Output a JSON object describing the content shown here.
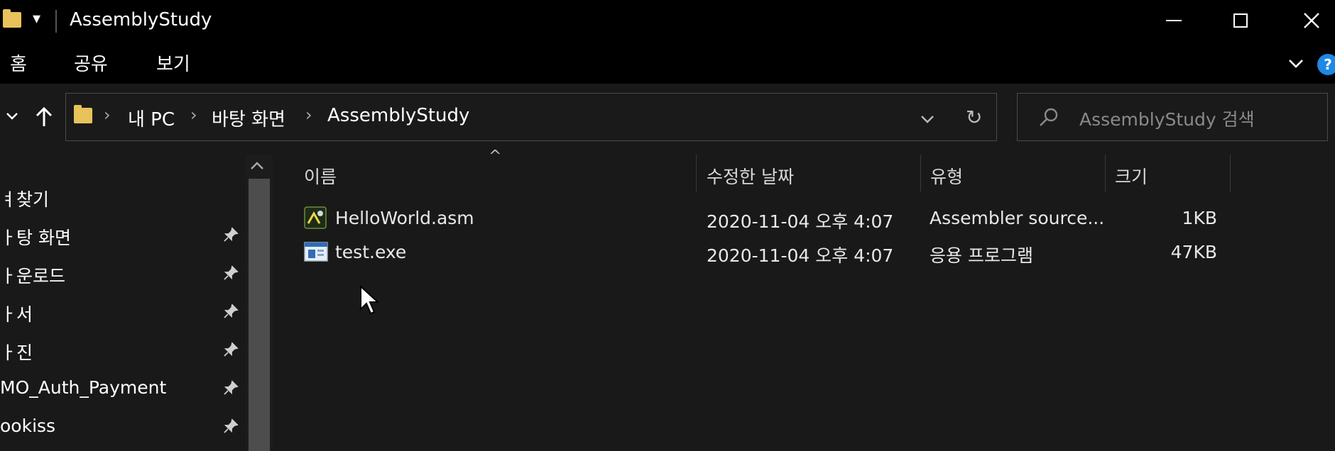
{
  "window": {
    "title": "AssemblyStudy",
    "minimize_label": "—",
    "maximize_label": "☐",
    "close_label": "✕",
    "quick_access_label": "▾"
  },
  "ribbon": {
    "tabs": [
      "홈",
      "공유",
      "보기"
    ],
    "expand_label": "⌄",
    "help_label": "?"
  },
  "address": {
    "crumbs": [
      "내 PC",
      "바탕 화면",
      "AssemblyStudy"
    ],
    "dropdown_label": "⌄",
    "refresh_label": "↻"
  },
  "search": {
    "placeholder": "AssemblyStudy 검색"
  },
  "nav": {
    "items": [
      {
        "label": "바로 찾기",
        "display": "ㅕ찾기",
        "pinned": false
      },
      {
        "label": "바탕 화면",
        "display": "ㅏ탕 화면",
        "pinned": true
      },
      {
        "label": "다운로드",
        "display": "ㅏ운로드",
        "pinned": true
      },
      {
        "label": "문서",
        "display": "ㅏ서",
        "pinned": true
      },
      {
        "label": "사진",
        "display": "ㅏ진",
        "pinned": true
      },
      {
        "label": "MO_Auth_Payment",
        "display": "MO_Auth_Payment",
        "pinned": true
      },
      {
        "label": "ookiss",
        "display": "ookiss",
        "pinned": true
      }
    ]
  },
  "columns": {
    "name": "이름",
    "modified": "수정한 날짜",
    "type": "유형",
    "size": "크기",
    "sort_indicator": "^"
  },
  "files": [
    {
      "name": "HelloWorld.asm",
      "modified": "2020-11-04 오후 4:07",
      "type": "Assembler source...",
      "size": "1KB",
      "icon": "asm-file-icon"
    },
    {
      "name": "test.exe",
      "modified": "2020-11-04 오후 4:07",
      "type": "응용 프로그램",
      "size": "47KB",
      "icon": "exe-file-icon"
    }
  ],
  "colors": {
    "background": "#191919",
    "titlebar": "#000000",
    "folder": "#e8c25a",
    "help": "#1e88e5"
  }
}
